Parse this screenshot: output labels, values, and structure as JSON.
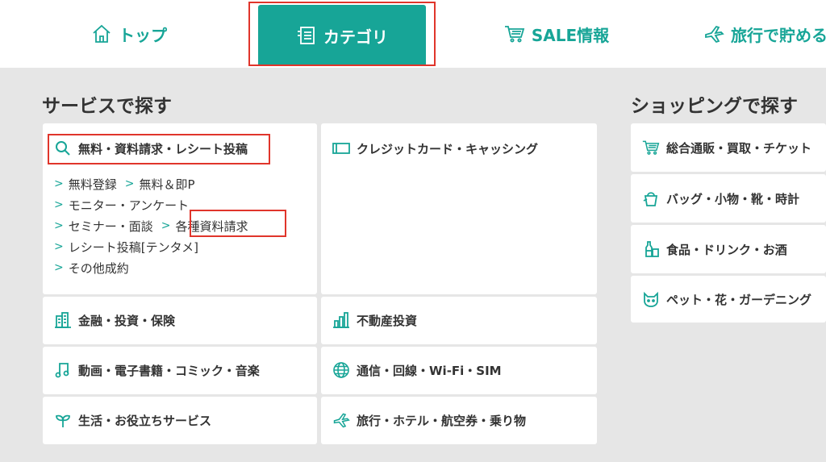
{
  "nav": {
    "top": "トップ",
    "category": "カテゴリ",
    "sale": "SALE情報",
    "travel": "旅行で貯める"
  },
  "sections": {
    "service": "サービスで探す",
    "shopping": "ショッピングで探す"
  },
  "service_cards": {
    "free": {
      "title": "無料・資料請求・レシート投稿",
      "links": {
        "free_register": "無料登録",
        "free_instant": "無料＆即P",
        "monitor": "モニター・アンケート",
        "seminar": "セミナー・面談",
        "documents": "各種資料請求",
        "receipt": "レシート投稿[テンタメ]",
        "other": "その他成約"
      }
    },
    "credit": "クレジットカード・キャッシング",
    "finance": "金融・投資・保険",
    "real_estate": "不動産投資",
    "media": "動画・電子書籍・コミック・音楽",
    "network": "通信・回線・Wi-Fi・SIM",
    "life": "生活・お役立ちサービス",
    "travel": "旅行・ホテル・航空券・乗り物"
  },
  "shopping_cards": {
    "general": "総合通販・買取・チケット",
    "bags": "バッグ・小物・靴・時計",
    "food": "食品・ドリンク・お酒",
    "pets": "ペット・花・ガーデニング"
  },
  "colors": {
    "accent": "#17a597",
    "highlight": "#e0352b"
  }
}
